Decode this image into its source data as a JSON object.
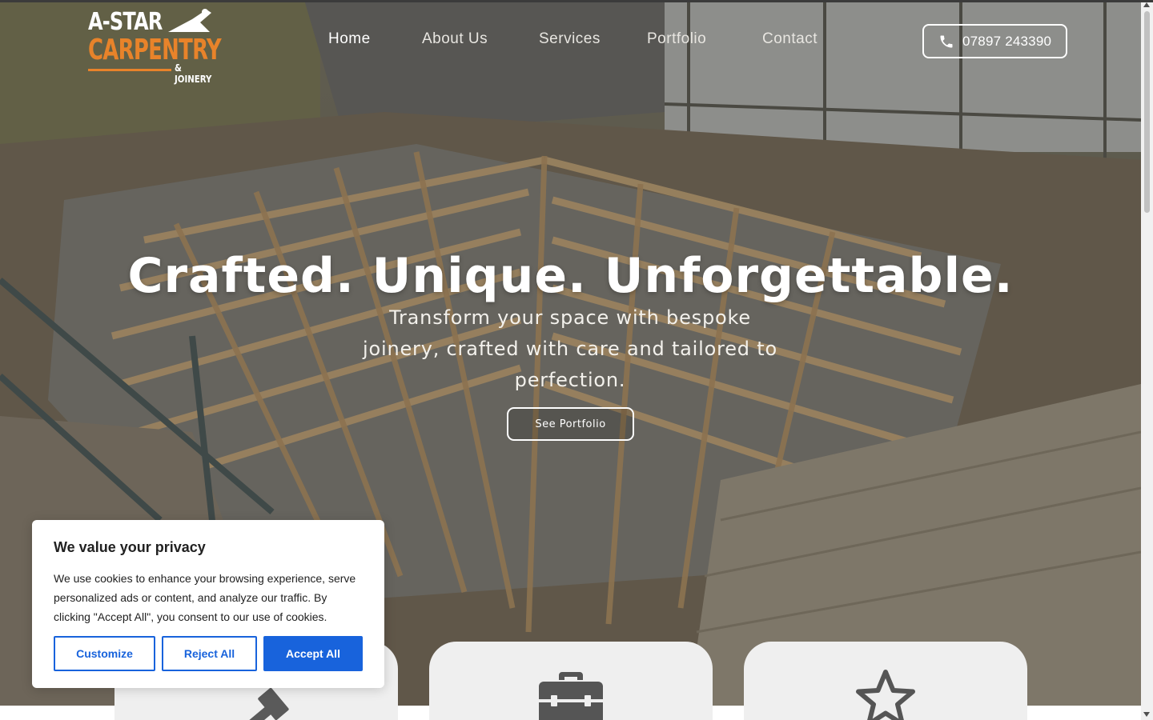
{
  "brand": {
    "line1": "A-STAR",
    "line2": "CARPENTRY",
    "line3": "& JOINERY",
    "accent_color": "#e8832a"
  },
  "nav": {
    "items": [
      {
        "label": "Home",
        "active": true
      },
      {
        "label": "About Us",
        "active": false
      },
      {
        "label": "Services",
        "active": false
      },
      {
        "label": "Portfolio",
        "active": false
      },
      {
        "label": "Contact",
        "active": false
      }
    ]
  },
  "phone": {
    "number": "07897 243390",
    "icon": "phone-icon"
  },
  "hero": {
    "headline": "Crafted. Unique. Unforgettable.",
    "subline": "Transform your space with bespoke joinery, crafted with care and tailored to perfection.",
    "cta_label": "See Portfolio"
  },
  "cards": [
    {
      "icon": "hammer-icon"
    },
    {
      "icon": "toolbox-icon"
    },
    {
      "icon": "star-icon"
    }
  ],
  "cookie_banner": {
    "title": "We value your privacy",
    "body": "We use cookies to enhance your browsing experience, serve personalized ads or content, and analyze our traffic. By clicking \"Accept All\", you consent to our use of cookies.",
    "customize_label": "Customize",
    "reject_label": "Reject All",
    "accept_label": "Accept All",
    "accent_color": "#1863dc"
  }
}
